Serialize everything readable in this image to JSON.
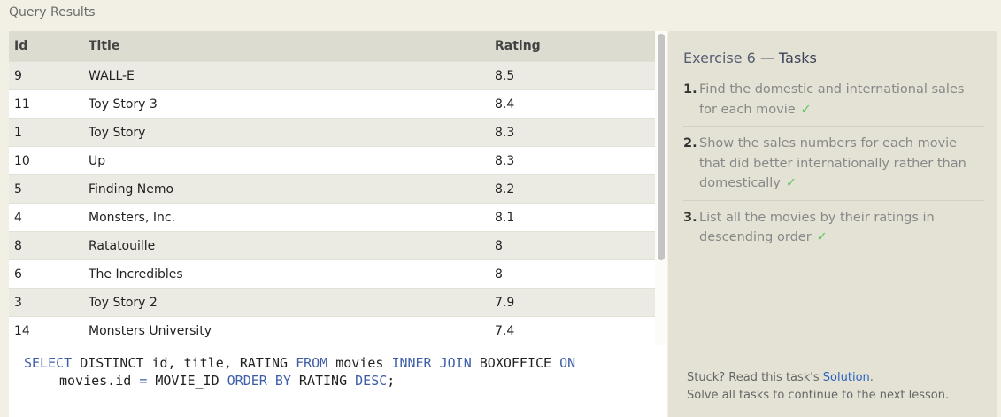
{
  "header": {
    "title": "Query Results"
  },
  "table": {
    "columns": [
      "Id",
      "Title",
      "Rating"
    ],
    "rows": [
      [
        "9",
        "WALL-E",
        "8.5"
      ],
      [
        "11",
        "Toy Story 3",
        "8.4"
      ],
      [
        "1",
        "Toy Story",
        "8.3"
      ],
      [
        "10",
        "Up",
        "8.3"
      ],
      [
        "5",
        "Finding Nemo",
        "8.2"
      ],
      [
        "4",
        "Monsters, Inc.",
        "8.1"
      ],
      [
        "8",
        "Ratatouille",
        "8"
      ],
      [
        "6",
        "The Incredibles",
        "8"
      ],
      [
        "3",
        "Toy Story 2",
        "7.9"
      ],
      [
        "14",
        "Monsters University",
        "7.4"
      ]
    ]
  },
  "editor": {
    "tokens_line1": [
      {
        "t": "SELECT",
        "kw": true
      },
      {
        "t": " DISTINCT id, title, RATING ",
        "kw": false
      },
      {
        "t": "FROM",
        "kw": true
      },
      {
        "t": " movies ",
        "kw": false
      },
      {
        "t": "INNER JOIN",
        "kw": true
      },
      {
        "t": " BOXOFFICE ",
        "kw": false
      },
      {
        "t": "ON",
        "kw": true
      }
    ],
    "tokens_line2": [
      {
        "t": "movies.id ",
        "kw": false
      },
      {
        "t": "=",
        "kw": true
      },
      {
        "t": " MOVIE_ID ",
        "kw": false
      },
      {
        "t": "ORDER BY",
        "kw": true
      },
      {
        "t": " RATING ",
        "kw": false
      },
      {
        "t": "DESC",
        "kw": true
      },
      {
        "t": ";",
        "kw": false
      }
    ]
  },
  "panel": {
    "exercise": "Exercise 6",
    "separator": " — ",
    "tasks_label": "Tasks",
    "tasks": [
      {
        "num": "1.",
        "text": "Find the domestic and international sales for each movie",
        "check": "✓"
      },
      {
        "num": "2.",
        "text": "Show the sales numbers for each movie that did better internationally rather than domestically",
        "check": "✓"
      },
      {
        "num": "3.",
        "text": "List all the movies by their ratings in descending order",
        "check": "✓"
      }
    ],
    "footer_prefix": "Stuck? Read this task's ",
    "footer_link": "Solution",
    "footer_suffix": ".",
    "footer_line2": "Solve all tasks to continue to the next lesson."
  },
  "colors": {
    "keyword": "#3e5da8",
    "check": "#5ec65e",
    "link": "#2a63bf"
  }
}
